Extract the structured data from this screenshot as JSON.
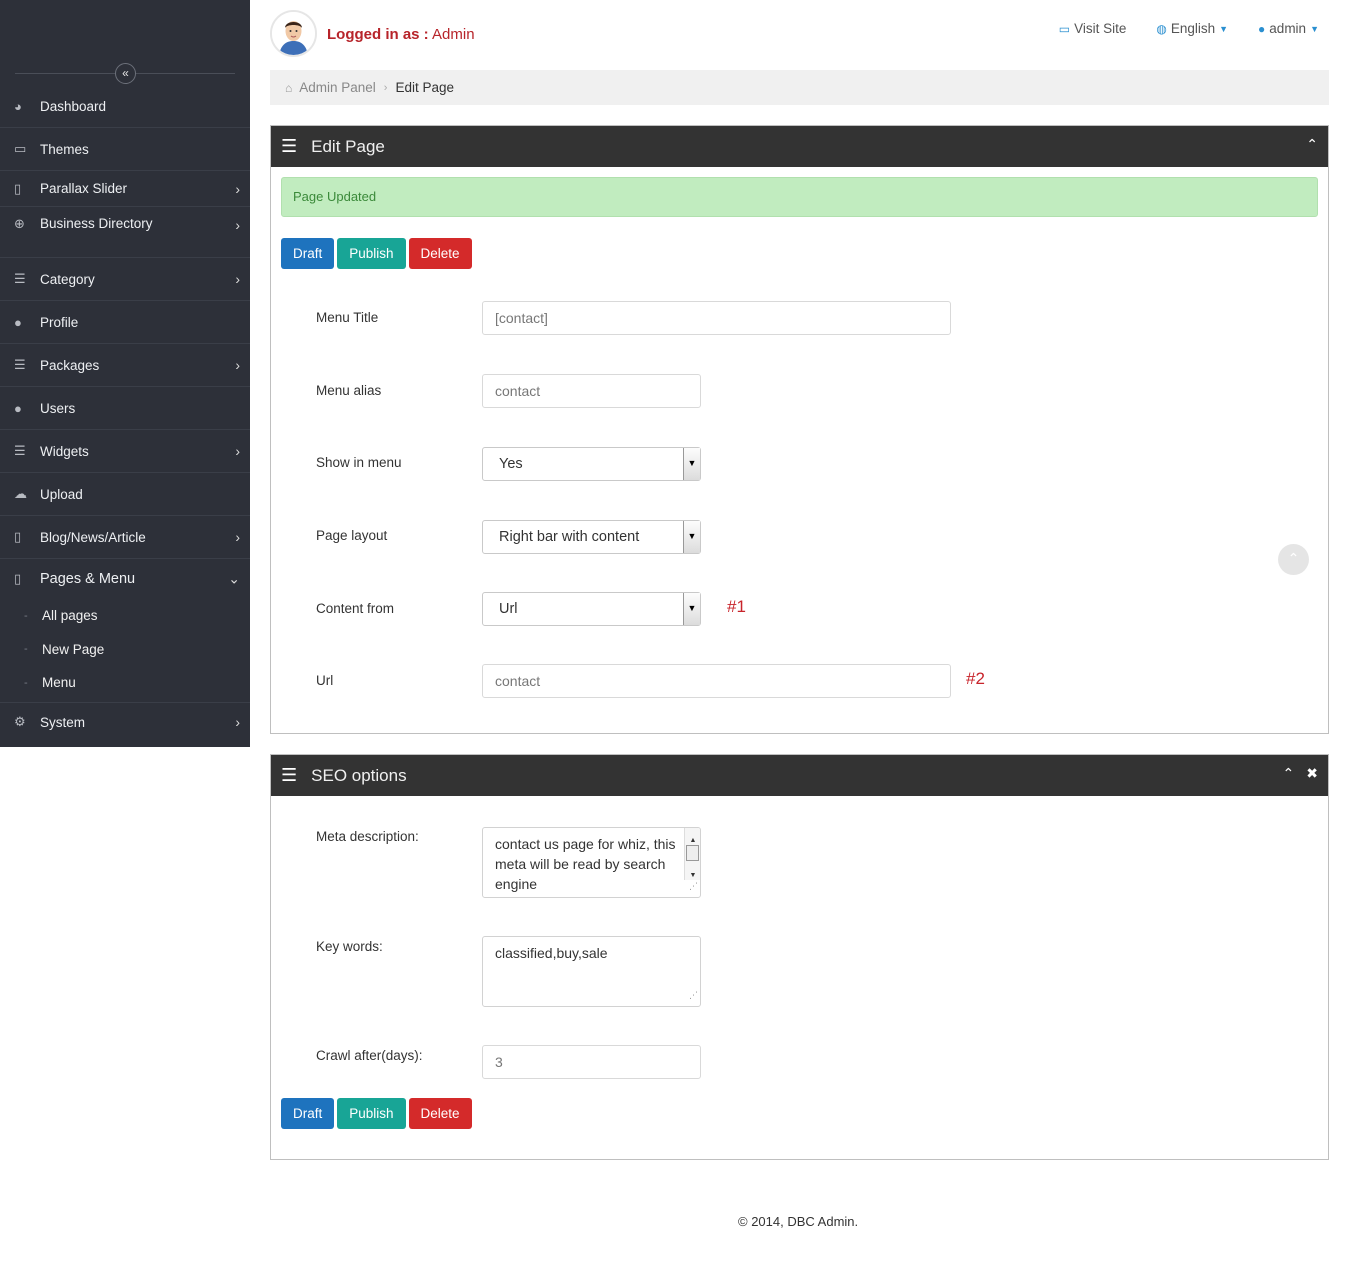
{
  "sidebar": {
    "collapse_icon": "double-chevron-left-icon",
    "items": [
      {
        "label": "Dashboard",
        "icon": "dashboard-icon",
        "glyph": "◕",
        "has_children": false
      },
      {
        "label": "Themes",
        "icon": "monitor-icon",
        "glyph": "▭",
        "has_children": false
      },
      {
        "label": "Parallax Slider",
        "icon": "file-icon",
        "glyph": "▯",
        "has_children": true
      },
      {
        "label": "Business Directory",
        "icon": "plus-circle-icon",
        "glyph": "⊕",
        "has_children": true
      },
      {
        "label": "Category",
        "icon": "list-icon",
        "glyph": "☰",
        "has_children": true
      },
      {
        "label": "Profile",
        "icon": "user-icon",
        "glyph": "●",
        "has_children": false
      },
      {
        "label": "Packages",
        "icon": "list-icon",
        "glyph": "☰",
        "has_children": true
      },
      {
        "label": "Users",
        "icon": "users-icon",
        "glyph": "●",
        "has_children": false
      },
      {
        "label": "Widgets",
        "icon": "list-icon",
        "glyph": "☰",
        "has_children": true
      },
      {
        "label": "Upload",
        "icon": "cloud-upload-icon",
        "glyph": "☁",
        "has_children": false
      },
      {
        "label": "Blog/News/Article",
        "icon": "file-icon",
        "glyph": "▯",
        "has_children": true
      },
      {
        "label": "Pages & Menu",
        "icon": "file-icon",
        "glyph": "▯",
        "has_children": true,
        "expanded": true
      }
    ],
    "sub_items": [
      "All pages",
      "New Page",
      "Menu"
    ],
    "system": {
      "label": "System",
      "icon": "gear-icon",
      "glyph": "⚙"
    }
  },
  "topbar": {
    "logged_in_label": "Logged in as :",
    "logged_in_user": "Admin",
    "visit_site": "Visit Site",
    "language": "English",
    "user_menu": "admin"
  },
  "breadcrumb": {
    "home": "Admin Panel",
    "current": "Edit Page"
  },
  "edit_panel": {
    "title": "Edit Page",
    "alert": "Page Updated",
    "buttons": {
      "draft": "Draft",
      "publish": "Publish",
      "delete": "Delete"
    },
    "fields": {
      "menu_title": {
        "label": "Menu Title",
        "value": "[contact]"
      },
      "menu_alias": {
        "label": "Menu alias",
        "value": "contact"
      },
      "show_in_menu": {
        "label": "Show in menu",
        "value": "Yes"
      },
      "page_layout": {
        "label": "Page layout",
        "value": "Right bar with content"
      },
      "content_from": {
        "label": "Content from",
        "value": "Url",
        "marker": "#1"
      },
      "url": {
        "label": "Url",
        "value": "contact",
        "marker": "#2"
      }
    }
  },
  "seo_panel": {
    "title": "SEO options",
    "fields": {
      "meta_description": {
        "label": "Meta description:",
        "value": "contact us page for whiz, this meta will be read by search engine"
      },
      "keywords": {
        "label": "Key words:",
        "value": "classified,buy,sale"
      },
      "crawl_after": {
        "label": "Crawl after(days):",
        "value": "3"
      }
    },
    "buttons": {
      "draft": "Draft",
      "publish": "Publish",
      "delete": "Delete"
    }
  },
  "footer": {
    "text": "© 2014, DBC Admin."
  }
}
